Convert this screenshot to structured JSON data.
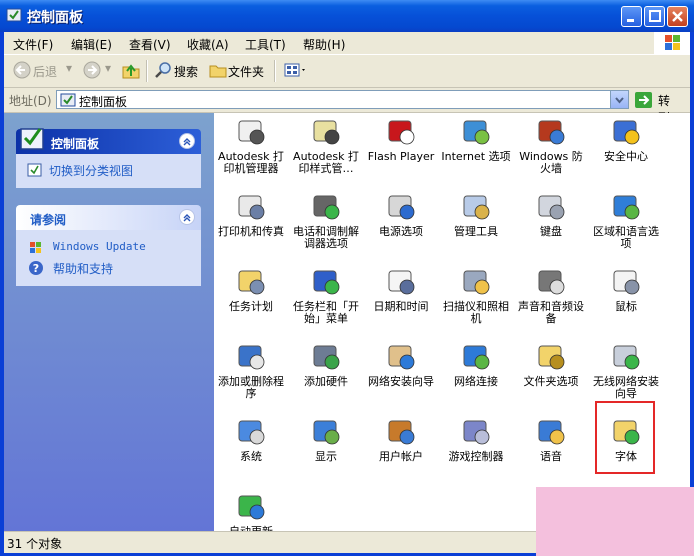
{
  "window": {
    "title": "控制面板"
  },
  "menu": [
    "文件(F)",
    "编辑(E)",
    "查看(V)",
    "收藏(A)",
    "工具(T)",
    "帮助(H)"
  ],
  "toolbar": {
    "back": "后退",
    "search": "搜索",
    "folders": "文件夹"
  },
  "address": {
    "label": "地址(D)",
    "value": "控制面板",
    "go": "转到"
  },
  "sidebar": {
    "control_panel": {
      "title": "控制面板",
      "switch_link": "切换到分类视图"
    },
    "see_also": {
      "title": "请参阅",
      "links": [
        "Windows Update",
        "帮助和支持"
      ]
    }
  },
  "items": [
    "Autodesk 打印机管理器",
    "Autodesk 打印样式管…",
    "Flash Player",
    "Internet 选项",
    "Windows 防火墙",
    "安全中心",
    "打印机和传真",
    "电话和调制解调器选项",
    "电源选项",
    "管理工具",
    "键盘",
    "区域和语言选项",
    "任务计划",
    "任务栏和「开始」菜单",
    "日期和时间",
    "扫描仪和照相机",
    "声音和音频设备",
    "鼠标",
    "添加或删除程序",
    "添加硬件",
    "网络安装向导",
    "网络连接",
    "文件夹选项",
    "无线网络安装向导",
    "系统",
    "显示",
    "用户帐户",
    "游戏控制器",
    "语音",
    "字体",
    "自动更新"
  ],
  "status": {
    "text": "31 个对象"
  }
}
